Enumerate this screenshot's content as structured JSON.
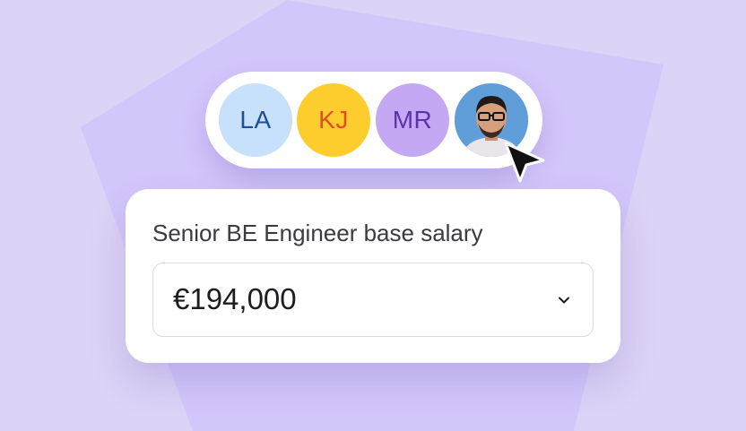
{
  "theme": {
    "background": "#dcd3f6",
    "shape_color": "#d3c6fa",
    "card_background": "#ffffff"
  },
  "avatars": [
    {
      "initials": "LA",
      "bg": "#c7e0fb",
      "fg": "#1f4e94"
    },
    {
      "initials": "KJ",
      "bg": "#fdcd2e",
      "fg": "#e04e22"
    },
    {
      "initials": "MR",
      "bg": "#c4a8f4",
      "fg": "#5b33a8"
    },
    {
      "photo": "user-photo",
      "bg": "#5f9ed9"
    }
  ],
  "cursor_icon": "pointer-arrow-icon",
  "salary_field": {
    "label": "Senior BE Engineer base salary",
    "value": "€194,000",
    "dropdown_icon": "chevron-down-icon"
  }
}
